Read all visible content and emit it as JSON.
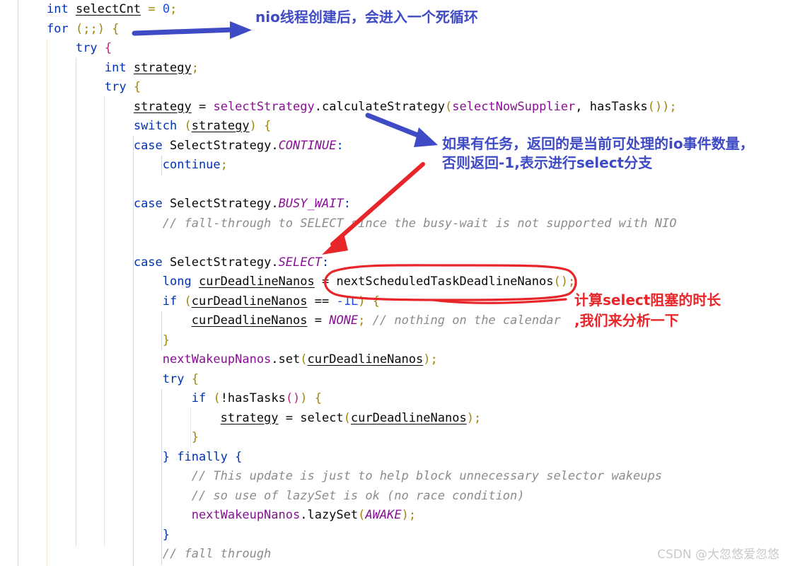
{
  "editor": {
    "language": "java",
    "background_color": "#ffffff",
    "gutter_rule_color": "#ccd4de",
    "font_size_px": 17,
    "line_height_px": 27.5,
    "code_lines": [
      "int selectCnt = 0;",
      "for (;;) {",
      "    try {",
      "        int strategy;",
      "        try {",
      "            strategy = selectStrategy.calculateStrategy(selectNowSupplier, hasTasks());",
      "            switch (strategy) {",
      "            case SelectStrategy.CONTINUE:",
      "                continue;",
      "",
      "            case SelectStrategy.BUSY_WAIT:",
      "                // fall-through to SELECT since the busy-wait is not supported with NIO",
      "",
      "            case SelectStrategy.SELECT:",
      "                long curDeadlineNanos = nextScheduledTaskDeadlineNanos();",
      "                if (curDeadlineNanos == -1L) {",
      "                    curDeadlineNanos = NONE; // nothing on the calendar",
      "                }",
      "                nextWakeupNanos.set(curDeadlineNanos);",
      "                try {",
      "                    if (!hasTasks()) {",
      "                        strategy = select(curDeadlineNanos);",
      "                    }",
      "                } finally {",
      "                    // This update is just to help block unnecessary selector wakeups",
      "                    // so use of lazySet is ok (no race condition)",
      "                    nextWakeupNanos.lazySet(AWAKE);",
      "                }",
      "                // fall through"
    ],
    "syntax_colors": {
      "keyword": "#0033b3",
      "identifier": "#080808",
      "field": "#871094",
      "static_constant": "#871094",
      "number": "#1750eb",
      "bracket": "#a1860b",
      "comment": "#8c8c8c",
      "magenta_brace": "#bf1f87"
    }
  },
  "annotations": [
    {
      "id": "annotation-loop",
      "text": "nio线程创建后，会进入一个死循环",
      "color": "#3f4bc4",
      "marker": "blue-arrow-right"
    },
    {
      "id": "annotation-strategy",
      "line1": "如果有任务，返回的是当前可处理的io事件数量，",
      "line2": "否则返回-1,表示进行select分支",
      "color": "#3f4bc4",
      "marker": "blue-arrow-down-right"
    },
    {
      "id": "annotation-deadline",
      "line1": "计算select阻塞的时长",
      "line2": ",我们来分析一下",
      "color": "#e8262a",
      "marker": "red-ellipse"
    }
  ],
  "markers": {
    "blue_arrow_color": "#3f4bc4",
    "red_arrow_color": "#e8262a",
    "red_ellipse_color": "#e8262a"
  },
  "watermark": {
    "text": "CSDN @大忽悠爱忽悠",
    "color": "#c9c9c9"
  }
}
